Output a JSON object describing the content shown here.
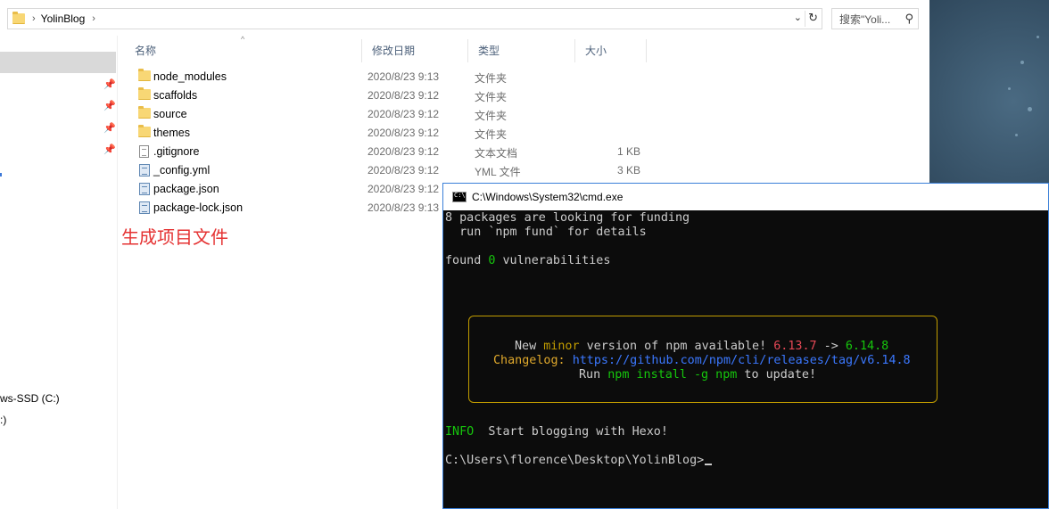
{
  "explorer": {
    "breadcrumb": "YolinBlog",
    "search_placeholder": "搜索\"Yoli...",
    "columns": {
      "name": "名称",
      "date": "修改日期",
      "type": "类型",
      "size": "大小"
    },
    "files": [
      {
        "name": "node_modules",
        "date": "2020/8/23 9:13",
        "type": "文件夹",
        "size": "",
        "icon": "folder-icon"
      },
      {
        "name": "scaffolds",
        "date": "2020/8/23 9:12",
        "type": "文件夹",
        "size": "",
        "icon": "folder-icon"
      },
      {
        "name": "source",
        "date": "2020/8/23 9:12",
        "type": "文件夹",
        "size": "",
        "icon": "folder-icon"
      },
      {
        "name": "themes",
        "date": "2020/8/23 9:12",
        "type": "文件夹",
        "size": "",
        "icon": "folder-icon"
      },
      {
        "name": ".gitignore",
        "date": "2020/8/23 9:12",
        "type": "文本文档",
        "size": "1 KB",
        "icon": "text-file-icon"
      },
      {
        "name": "_config.yml",
        "date": "2020/8/23 9:12",
        "type": "YML 文件",
        "size": "3 KB",
        "icon": "code-file-icon"
      },
      {
        "name": "package.json",
        "date": "2020/8/23 9:12",
        "type": "",
        "size": "",
        "icon": "code-file-icon"
      },
      {
        "name": "package-lock.json",
        "date": "2020/8/23 9:13",
        "type": "",
        "size": "",
        "icon": "code-file-icon"
      }
    ],
    "nav_drive_1": "ws-SSD (C:)",
    "nav_drive_2": ":)",
    "annotation": "生成项目文件"
  },
  "cmd": {
    "title": "C:\\Windows\\System32\\cmd.exe",
    "line1": "8 packages are looking for funding",
    "line2": "  run `npm fund` for details",
    "line3_a": "found ",
    "line3_b": "0",
    "line3_c": " vulnerabilities",
    "upd_a": "New ",
    "upd_b": "minor",
    "upd_c": " version of npm available! ",
    "upd_d": "6.13.7",
    "upd_e": " -> ",
    "upd_f": "6.14.8",
    "chg_a": "Changelog: ",
    "chg_b": "https://github.com/npm/cli/releases/tag/v6.14.8",
    "run_a": "Run ",
    "run_b": "npm install -g npm",
    "run_c": " to update!",
    "info_a": "INFO",
    "info_b": "  Start blogging with Hexo!",
    "prompt": "C:\\Users\\florence\\Desktop\\YolinBlog>"
  },
  "colors": {
    "annotation": "#e53333",
    "cmd_bg": "#0c0c0c",
    "cmd_fg": "#cccccc",
    "accent_border": "#3a7fd8"
  }
}
